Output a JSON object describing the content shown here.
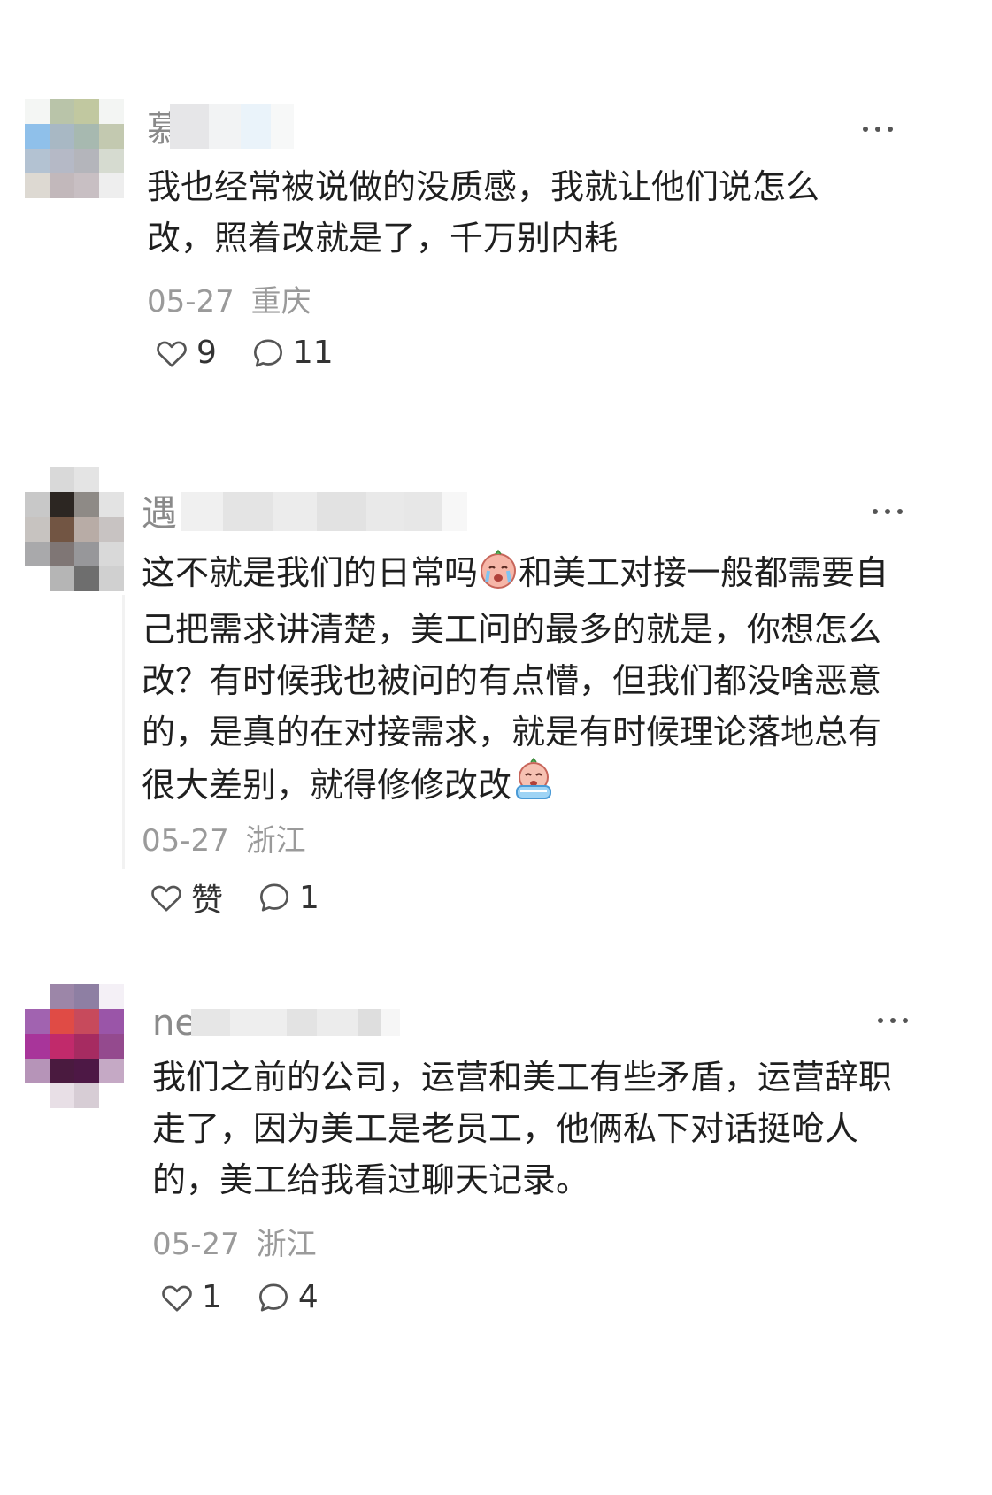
{
  "comments": [
    {
      "username_visible": "慕",
      "more_label": "···",
      "text": "我也经常被说做的没质感，我就让他们说怎么改，照着改就是了，千万别内耗",
      "date": "05-27",
      "location": "重庆",
      "likes": "9",
      "replies": "11"
    },
    {
      "username_visible": "遇",
      "more_label": "···",
      "text_part1": "这不就是我们的日常吗",
      "text_part2": "和美工对接一般都需要自己把需求讲清楚，美工问的最多的就是，你想怎么改？有时候我也被问的有点懵，但我们都没啥恶意的，是真的在对接需求，就是有时候理论落地总有很大差别，就得修修改改",
      "emoji1": "crying-face-emoji",
      "emoji2": "weeping-face-emoji",
      "date": "05-27",
      "location": "浙江",
      "likes": "赞",
      "replies": "1"
    },
    {
      "username_visible": "ne",
      "more_label": "···",
      "text": "我们之前的公司，运营和美工有些矛盾，运营辞职走了，因为美工是老员工，他俩私下对话挺呛人的，美工给我看过聊天记录。",
      "date": "05-27",
      "location": "浙江",
      "likes": "1",
      "replies": "4"
    }
  ],
  "icons": {
    "like": "heart-outline-icon",
    "reply": "speech-bubble-icon",
    "more": "more-dots-icon"
  },
  "colors": {
    "text": "#1f1f1f",
    "meta": "#9a9a9a",
    "icon": "#555555"
  }
}
